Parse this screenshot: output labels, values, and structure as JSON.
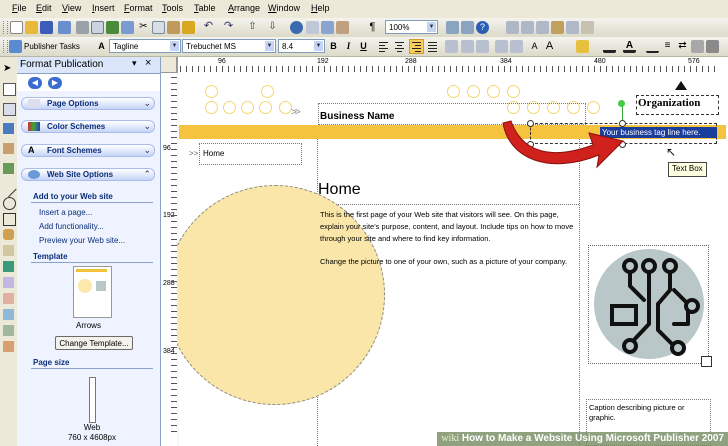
{
  "menu": [
    "File",
    "Edit",
    "View",
    "Insert",
    "Format",
    "Tools",
    "Table",
    "Arrange",
    "Window",
    "Help"
  ],
  "toolbar1": {
    "zoom": "100%"
  },
  "toolbar2": {
    "task_pane_label": "Publisher Tasks",
    "style": "Tagline",
    "font": "Trebuchet MS",
    "size": "8.4",
    "bold": "B",
    "italic": "I",
    "underline": "U"
  },
  "taskpane": {
    "title": "Format Publication",
    "sections": [
      "Page Options",
      "Color Schemes",
      "Font Schemes",
      "Web Site Options"
    ],
    "add_heading": "Add to your Web site",
    "links": [
      "Insert a page...",
      "Add functionality...",
      "Preview your Web site..."
    ],
    "template_heading": "Template",
    "template_name": "Arrows",
    "change_template": "Change Template...",
    "page_size_heading": "Page size",
    "page_size_type": "Web",
    "page_size_value": "760 x 4608px"
  },
  "rulers": {
    "horizontal": [
      "96",
      "192",
      "288",
      "384",
      "480",
      "576",
      "672"
    ],
    "vertical": [
      "96",
      "192",
      "288",
      "384"
    ]
  },
  "publication": {
    "business_name": "Business Name",
    "organization": "Organization",
    "tagline": "Your business tag line here.",
    "nav_home": "Home",
    "page_title": "Home",
    "paragraph1": "This is the first page of your Web site that visitors will see. On this page, explain your site's purpose, content, and layout. Include tips on how to move through your site and where to find key information.",
    "paragraph2": "Change the picture to one of your own, such as a picture of your company.",
    "caption": "Caption describing picture or graphic.",
    "tooltip": "Text Box"
  },
  "colors": {
    "band": "#f5c33d",
    "tagline_bg": "#1a3c9a",
    "arrow": "#d0211c",
    "circle": "#fbe6a9",
    "image_bg": "#b9c7c9"
  },
  "watermark": {
    "wiki": "wiki",
    "text": "How to Make a Website Using Microsoft Publisher 2007"
  }
}
